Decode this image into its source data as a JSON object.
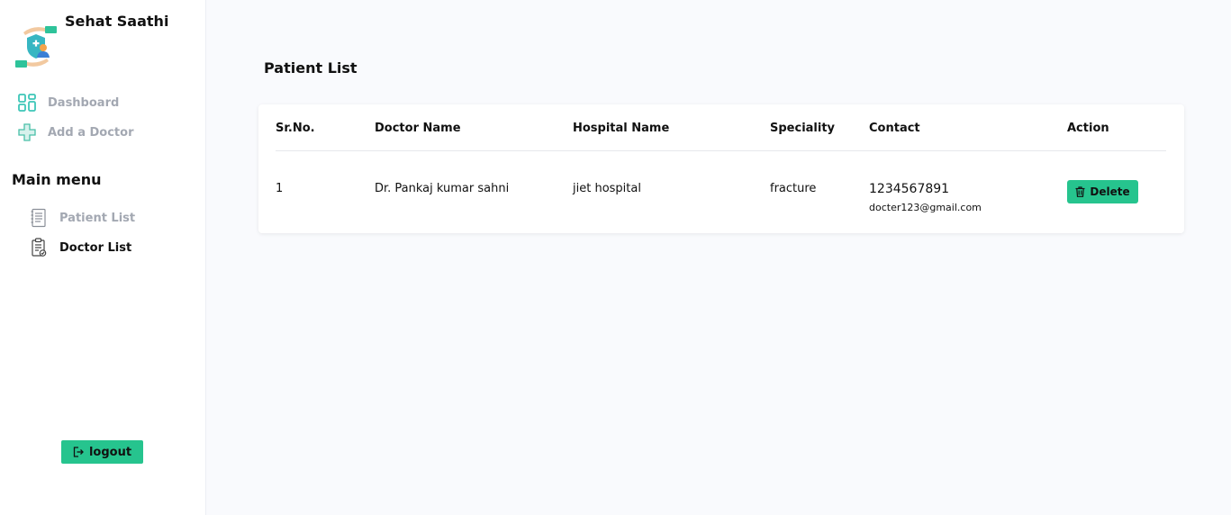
{
  "brand": {
    "name": "Sehat Saathi",
    "logo_icon": "care-hands-shield-doctor-icon"
  },
  "nav": {
    "items": [
      {
        "label": "Dashboard",
        "icon": "dashboard-grid-icon"
      },
      {
        "label": "Add a Doctor",
        "icon": "medical-cross-icon"
      }
    ]
  },
  "menu": {
    "title": "Main menu",
    "items": [
      {
        "label": "Patient List",
        "icon": "document-list-icon",
        "active": false
      },
      {
        "label": "Doctor List",
        "icon": "clipboard-check-icon",
        "active": true
      }
    ]
  },
  "logout": {
    "label": "logout",
    "icon": "logout-arrow-icon"
  },
  "page": {
    "title": "Patient List"
  },
  "table": {
    "headers": [
      "Sr.No.",
      "Doctor Name",
      "Hospital Name",
      "Speciality",
      "Contact",
      "Action"
    ],
    "rows": [
      {
        "sr_no": "1",
        "doctor_name": "Dr. Pankaj kumar sahni",
        "hospital_name": "jiet hospital",
        "speciality": "fracture",
        "phone": "1234567891",
        "email": "docter123@gmail.com",
        "action_label": "Delete",
        "action_icon": "trash-icon"
      }
    ]
  },
  "colors": {
    "accent": "#26c48e",
    "background": "#f9fafd",
    "sidebar": "#ffffff",
    "muted_text": "#a3a8b2"
  }
}
